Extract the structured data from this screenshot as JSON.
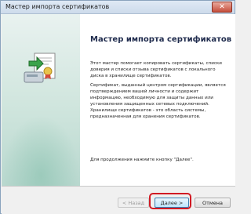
{
  "window": {
    "title": "Мастер импорта сертификатов",
    "close_glyph": "✕"
  },
  "wizard": {
    "heading": "Мастер импорта сертификатов",
    "paragraph1": "Этот мастер помогает копировать сертификаты, списки доверия и списки отзыва сертификатов с локального диска в хранилище сертификатов.",
    "paragraph2": "Сертификат, выданный центром сертификации, является подтверждением вашей личности и содержит информацию, необходимую для защиты данных или установления защищенных сетевых подключений. Хранилище сертификатов - это область системы, предназначенная для хранения сертификатов.",
    "paragraph3": "Для продолжения нажмите кнопку \"Далее\"."
  },
  "buttons": {
    "back": "< Назад",
    "next": "Далее >",
    "cancel": "Отмена"
  },
  "icons": {
    "wizard": "certificate-import-icon",
    "close": "close-icon"
  },
  "colors": {
    "highlight": "#d11a24",
    "left_panel": "#cfe5dd",
    "title_text": "#1f2b4d"
  }
}
